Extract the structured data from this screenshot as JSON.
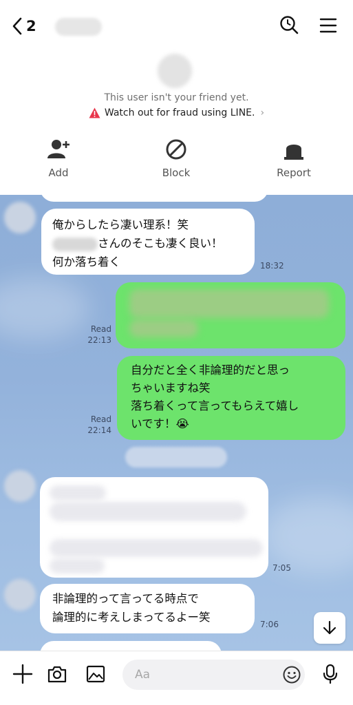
{
  "header": {
    "unread_count": "2"
  },
  "notice": {
    "line1": "This user isn't your friend yet.",
    "line2": "Watch out for fraud using LINE.",
    "line2_chevron": "›"
  },
  "actions": {
    "add": "Add",
    "block": "Block",
    "report": "Report"
  },
  "messages": [
    {
      "side": "left",
      "lines": [
        "俺からしたら凄い理系！笑",
        "さんのそこも凄く良い！",
        "何か落ち着く"
      ],
      "time": "18:32"
    },
    {
      "side": "right",
      "read": "Read",
      "time": "22:13"
    },
    {
      "side": "right",
      "lines": [
        "自分だと全く非論理的だと思っ",
        "ちゃいますね笑",
        "落ち着くって言ってもらえて嬉し",
        "いです！😭"
      ],
      "read": "Read",
      "time": "22:14"
    },
    {
      "side": "left",
      "time": "7:05"
    },
    {
      "side": "left",
      "lines": [
        "非論理的って言ってる時点で",
        "論理的に考えしまってるよー笑"
      ],
      "time": "7:06"
    },
    {
      "side": "left",
      "lines": [
        "…"
      ]
    }
  ],
  "composer": {
    "placeholder": "Aa"
  },
  "colors": {
    "bubble_green": "#6de36c",
    "chat_bg": "#8eaed8",
    "warning_red": "#e8364b"
  }
}
